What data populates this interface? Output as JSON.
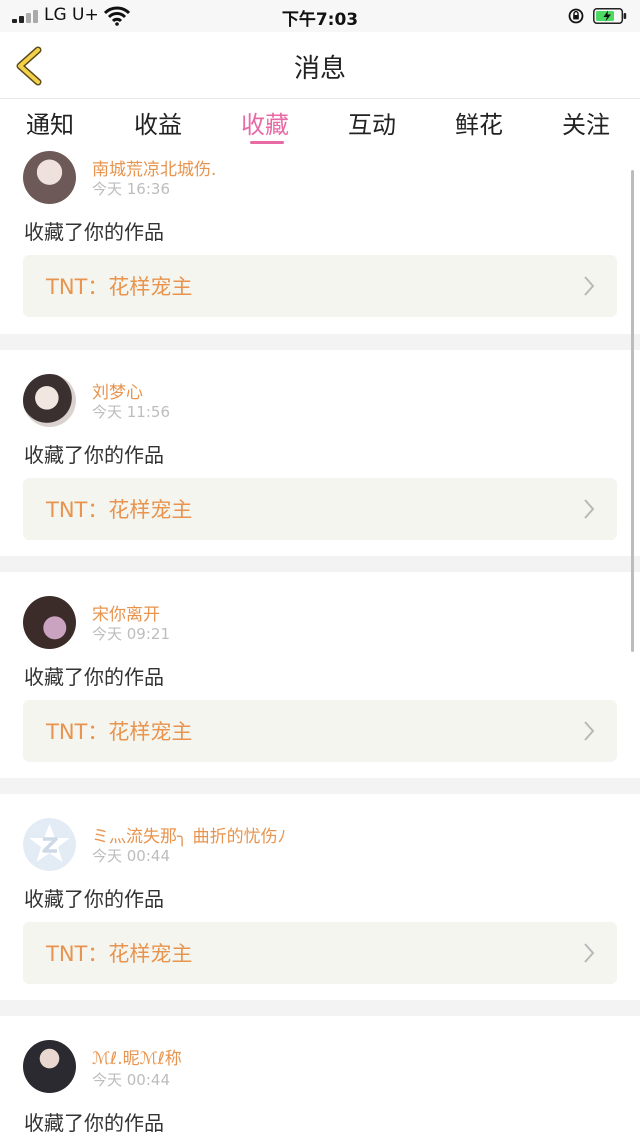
{
  "status_bar": {
    "carrier": "LG U+",
    "time": "下午7:03"
  },
  "header": {
    "title": "消息"
  },
  "tabs": [
    {
      "label": "通知"
    },
    {
      "label": "收益"
    },
    {
      "label": "收藏"
    },
    {
      "label": "互动"
    },
    {
      "label": "鲜花"
    },
    {
      "label": "关注"
    }
  ],
  "active_tab": "收藏",
  "notifications": [
    {
      "user": "南城荒凉北城伤.",
      "time": "今天 16:36",
      "action": "收藏了你的作品",
      "work": "TNT：花样宠主"
    },
    {
      "user": "刘梦心",
      "time": "今天 11:56",
      "action": "收藏了你的作品",
      "work": "TNT：花样宠主"
    },
    {
      "user": "宋你离开",
      "time": "今天 09:21",
      "action": "收藏了你的作品",
      "work": "TNT：花样宠主"
    },
    {
      "user": "ミ灬流失那╮ 曲折的忧伤ﾉ",
      "time": "今天 00:44",
      "action": "收藏了你的作品",
      "work": "TNT：花样宠主"
    },
    {
      "user": "ℳℓ.昵ℳℓ称",
      "time": "今天 00:44",
      "action": "收藏了你的作品",
      "work": ""
    }
  ],
  "colors": {
    "accent": "#e86aa5",
    "username": "#e8944e",
    "work_title": "#e8944e",
    "work_bg": "#f5f5ef",
    "battery": "#4cd964"
  }
}
